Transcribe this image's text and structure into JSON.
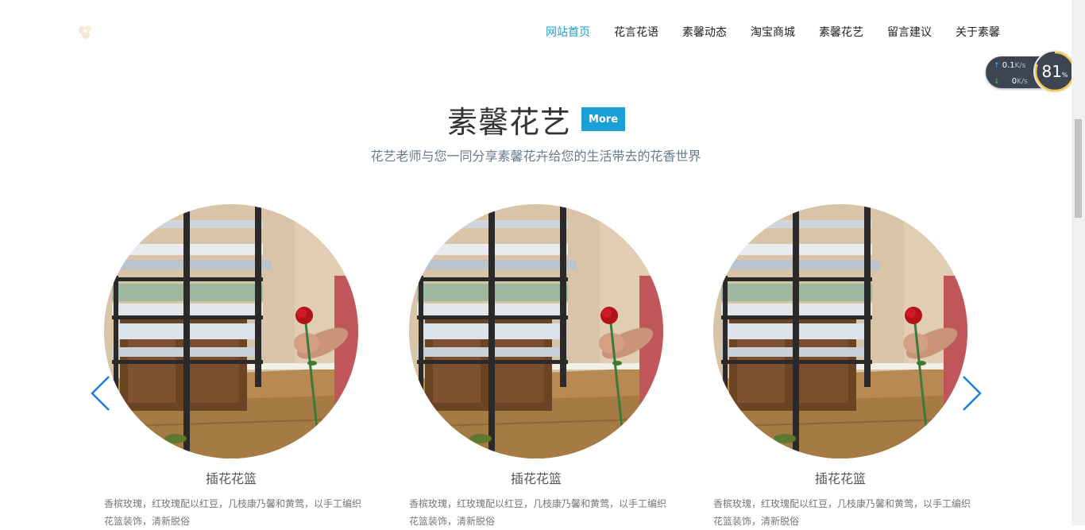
{
  "header": {
    "logo_icon": "flower-logo-icon",
    "nav": [
      {
        "label": "网站首页",
        "active": true
      },
      {
        "label": "花言花语",
        "active": false
      },
      {
        "label": "素馨动态",
        "active": false
      },
      {
        "label": "淘宝商城",
        "active": false
      },
      {
        "label": "素馨花艺",
        "active": false
      },
      {
        "label": "留言建议",
        "active": false
      },
      {
        "label": "关于素馨",
        "active": false
      }
    ]
  },
  "net_monitor": {
    "upload": "0.1",
    "download": "0",
    "unit": "K/s",
    "percent": "81",
    "percent_sign": "%",
    "percent_value": 0.81
  },
  "section": {
    "title": "素馨花艺",
    "more_label": "More",
    "subtitle": "花艺老师与您一同分享素馨花卉给您的生活带去的花香世界"
  },
  "cards": [
    {
      "title": "插花花篮",
      "desc": "香槟玫瑰，红玫瑰配以红豆，几枝康乃馨和黄莺，以手工编织花篮装饰，清新脱俗"
    },
    {
      "title": "插花花篮",
      "desc": "香槟玫瑰，红玫瑰配以红豆，几枝康乃馨和黄莺，以手工编织花篮装饰，清新脱俗"
    },
    {
      "title": "插花花篮",
      "desc": "香槟玫瑰，红玫瑰配以红豆，几枝康乃馨和黄莺，以手工编织花篮装饰，清新脱俗"
    }
  ],
  "carousel": {
    "prev_icon": "chevron-left-icon",
    "next_icon": "chevron-right-icon"
  },
  "colors": {
    "accent": "#1a9fd6",
    "arrow": "#1a7fe0"
  }
}
